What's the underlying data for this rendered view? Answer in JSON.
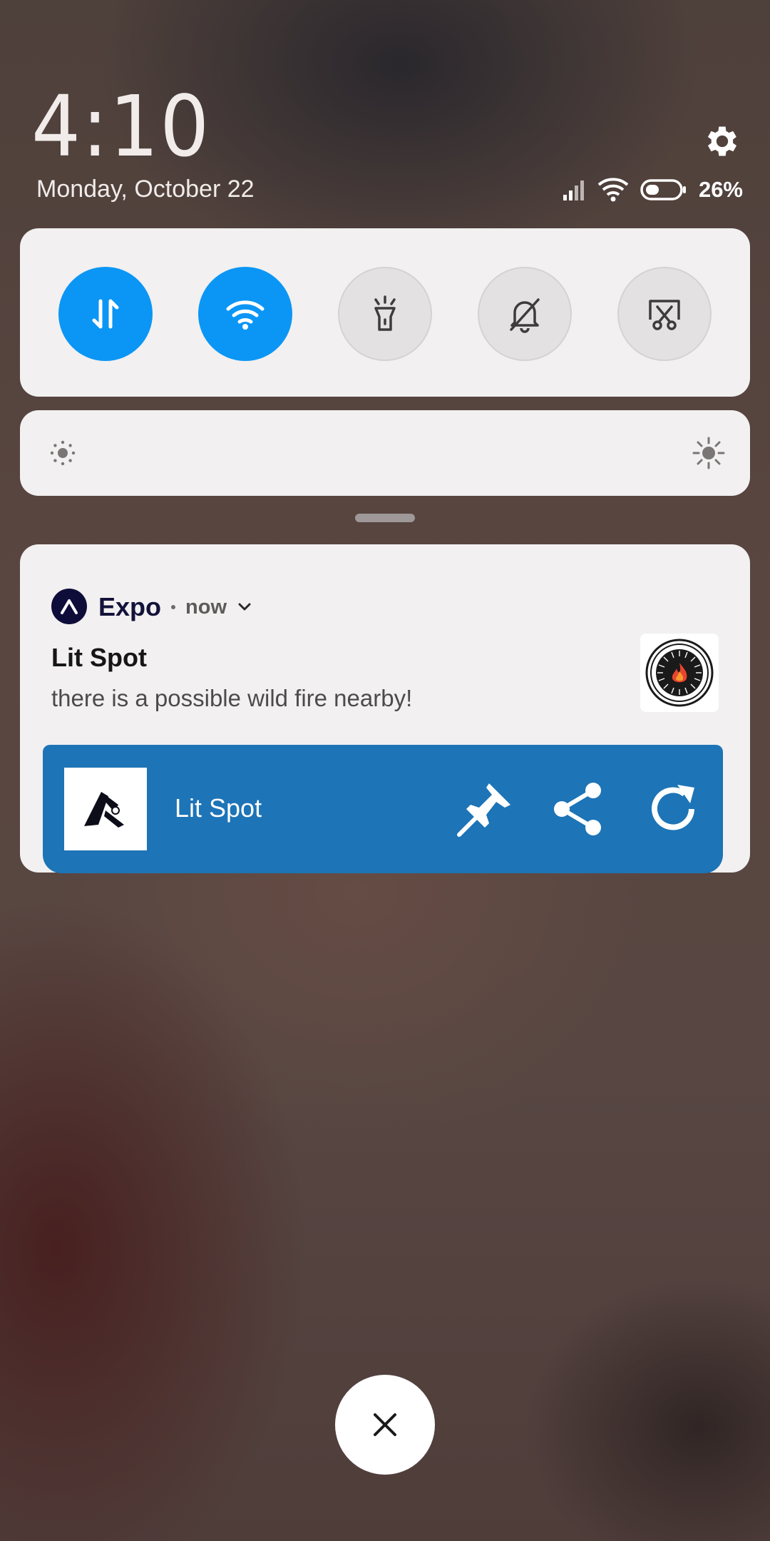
{
  "header": {
    "time": "4:10",
    "date": "Monday, October 22",
    "battery_percent": "26%"
  },
  "quick_toggles": [
    {
      "icon": "data-transfer-icon",
      "state": "on"
    },
    {
      "icon": "wifi-icon",
      "state": "on"
    },
    {
      "icon": "flashlight-icon",
      "state": "off"
    },
    {
      "icon": "mute-bell-icon",
      "state": "off"
    },
    {
      "icon": "screenshot-icon",
      "state": "off"
    }
  ],
  "brightness": {
    "low_icon": "brightness-low-icon",
    "high_icon": "brightness-high-icon"
  },
  "notification": {
    "app_name": "Expo",
    "time": "now",
    "title": "Lit Spot",
    "body": "there is a possible wild fire nearby!",
    "action_bar": {
      "title": "Lit Spot",
      "buttons": [
        "pin-icon",
        "share-icon",
        "refresh-icon"
      ]
    }
  },
  "colors": {
    "toggle_on": "#0b96f5",
    "action_bar": "#1d74b7",
    "card": "#f2f0f0"
  }
}
